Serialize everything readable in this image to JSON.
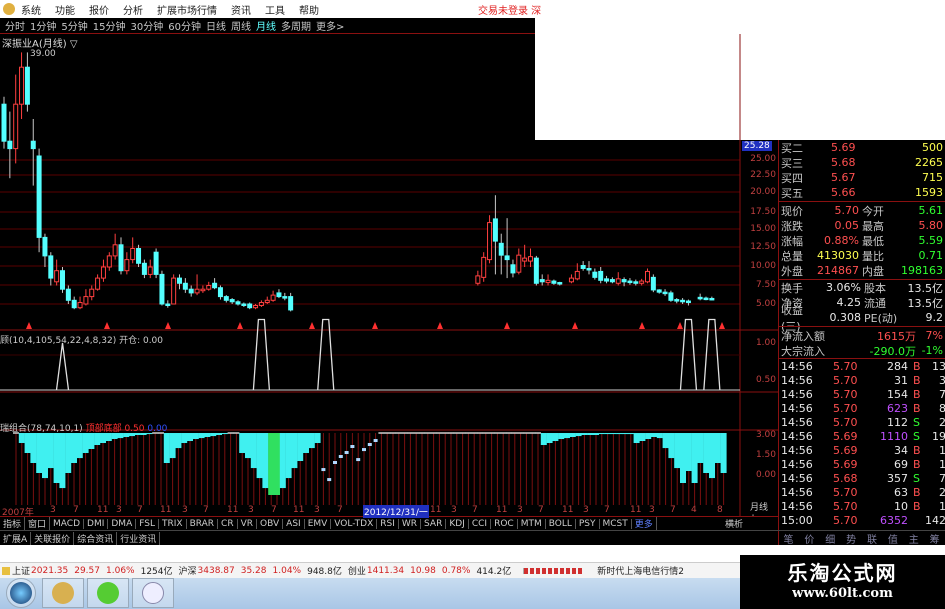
{
  "menu": {
    "items": [
      "系统",
      "功能",
      "报价",
      "分析",
      "扩展市场行情",
      "资讯",
      "工具",
      "帮助"
    ],
    "status": "交易未登录 深"
  },
  "periods": {
    "items": [
      "分时",
      "1分钟",
      "5分钟",
      "15分钟",
      "30分钟",
      "60分钟",
      "日线",
      "周线",
      "月线",
      "多周期",
      "更多>"
    ],
    "selected": "月线"
  },
  "chart": {
    "title": "深振业A(月线) ▽",
    "high_label": "39.00",
    "last_price_tag": "25.28",
    "price_axis": [
      "25.00",
      "22.50",
      "20.00",
      "17.50",
      "15.00",
      "12.50",
      "10.00",
      "7.50",
      "5.00"
    ],
    "colors": {
      "up": "#ff4040",
      "down": "#54ffff",
      "grid": "#5a0000",
      "marker": "#ff3030"
    },
    "candles_ohlc_note": "o,c,h,l per month; null = no trading",
    "candles": [
      [
        32,
        27,
        33,
        26
      ],
      [
        27,
        26,
        31,
        22
      ],
      [
        26,
        32,
        36,
        24
      ],
      [
        32,
        37,
        39,
        30
      ],
      [
        37,
        32,
        39,
        31
      ],
      [
        27,
        26,
        30,
        21
      ],
      [
        25,
        14,
        26,
        12
      ],
      [
        14,
        11.5,
        14.5,
        10
      ],
      [
        11.5,
        8.5,
        12,
        7.5
      ],
      [
        8,
        9.5,
        11,
        7.5
      ],
      [
        9.5,
        7,
        10,
        6.5
      ],
      [
        7,
        5.5,
        7.5,
        5
      ],
      [
        5.5,
        4.5,
        6,
        4.3
      ],
      [
        4.5,
        5.2,
        6,
        4.3
      ],
      [
        5,
        6,
        7,
        4.8
      ],
      [
        6,
        7,
        7.5,
        5.5
      ],
      [
        7,
        8.5,
        9,
        6.8
      ],
      [
        8.5,
        10,
        11,
        8
      ],
      [
        10,
        11.5,
        12,
        9.5
      ],
      [
        11.5,
        13,
        14.5,
        11
      ],
      [
        13,
        9.5,
        14,
        9
      ],
      [
        9.5,
        11,
        12,
        9
      ],
      [
        11,
        12.5,
        14,
        10.5
      ],
      [
        12.5,
        10.5,
        13,
        10
      ],
      [
        10.5,
        9,
        11,
        8.5
      ],
      [
        9,
        10,
        11,
        8.5
      ],
      [
        12,
        9,
        12.5,
        8.5
      ],
      [
        9,
        5,
        9.5,
        4.8
      ],
      [
        5,
        4.8,
        5.5,
        4.5
      ],
      [
        5,
        8.5,
        9,
        5
      ],
      [
        8.5,
        7.8,
        9,
        7
      ],
      [
        7.8,
        7,
        8.5,
        6.5
      ],
      [
        7,
        6.5,
        7.5,
        6
      ],
      [
        6.5,
        7,
        9,
        6.2
      ],
      [
        6.8,
        7,
        7.5,
        6.5
      ],
      [
        7,
        7.5,
        8,
        6.8
      ],
      [
        7.8,
        7.2,
        8.5,
        7
      ],
      [
        7.2,
        6,
        7.5,
        5.6
      ],
      [
        6,
        5.5,
        6.2,
        5.2
      ],
      [
        5.6,
        5.3,
        5.8,
        5
      ],
      [
        5.3,
        5,
        5.5,
        4.8
      ],
      [
        5,
        4.9,
        5.2,
        4.6
      ],
      [
        5,
        4.5,
        5.2,
        4.3
      ],
      [
        4.5,
        4.8,
        5,
        4.3
      ],
      [
        4.8,
        5.2,
        5.5,
        4.6
      ],
      [
        5.2,
        5.5,
        6,
        5
      ],
      [
        5.5,
        6.2,
        6.8,
        5.3
      ],
      [
        6.5,
        6,
        7,
        5.8
      ],
      [
        6,
        5.8,
        6.5,
        5.5
      ],
      [
        6,
        4.2,
        6.5,
        4
      ],
      null,
      null,
      null,
      null,
      null,
      null,
      null,
      null,
      null,
      null,
      null,
      null,
      null,
      null,
      null,
      null,
      null,
      null,
      null,
      null,
      null,
      null,
      null,
      null,
      null,
      null,
      null,
      null,
      null,
      null,
      null,
      [
        7.8,
        8.8,
        9.5,
        7.5
      ],
      [
        8.6,
        11.3,
        12,
        8
      ],
      [
        11,
        16,
        17,
        10.5
      ],
      [
        16.5,
        13.5,
        19.7,
        9
      ],
      [
        13.2,
        11.6,
        14.5,
        9
      ],
      [
        11.5,
        11,
        16.6,
        8.5
      ],
      [
        10.3,
        9.2,
        11,
        8.6
      ],
      [
        9.3,
        11.6,
        12.5,
        9
      ],
      [
        10.8,
        11.2,
        13,
        10
      ],
      [
        10.8,
        11.4,
        12.5,
        10
      ],
      [
        11.2,
        7.8,
        11.5,
        7.5
      ],
      [
        8.3,
        8,
        9,
        7.5
      ],
      [
        7.9,
        8.2,
        9,
        7.5
      ],
      [
        8.1,
        7.8,
        8.3,
        7.6
      ],
      [
        7.9,
        7.7,
        8,
        7.5
      ],
      null,
      [
        8,
        8.5,
        9,
        7.8
      ],
      [
        8.4,
        9.4,
        10.5,
        8.2
      ],
      [
        10.2,
        9.8,
        10.8,
        9.5
      ],
      [
        9.8,
        9.6,
        10.8,
        9
      ],
      [
        9.3,
        8.6,
        9.8,
        8.3
      ],
      [
        9.4,
        8.2,
        10,
        7.8
      ],
      [
        8.4,
        8.1,
        8.8,
        7.8
      ],
      [
        8.3,
        8,
        8.6,
        7.8
      ],
      [
        7.8,
        8.4,
        9.3,
        7.5
      ],
      [
        8.3,
        8,
        8.6,
        7.4
      ],
      [
        8.1,
        7.9,
        8.5,
        7.6
      ],
      [
        8,
        7.8,
        8.3,
        7.5
      ],
      [
        7.8,
        8.1,
        8.4,
        7.5
      ],
      [
        8,
        9.4,
        9.8,
        7.8
      ],
      [
        8.6,
        6.9,
        9,
        6.6
      ],
      [
        6.9,
        6.6,
        7,
        6.4
      ],
      [
        6.6,
        6.4,
        7,
        6.1
      ],
      [
        6.5,
        5.5,
        6.8,
        5.3
      ],
      [
        5.6,
        5.4,
        5.8,
        5.1
      ],
      [
        5.5,
        5.3,
        5.8,
        5
      ],
      [
        5.4,
        5.2,
        5.6,
        4.8
      ],
      null,
      [
        5.9,
        5.7,
        6.4,
        5.5
      ],
      [
        5.8,
        5.6,
        6,
        5.5
      ],
      [
        5.75,
        5.7,
        6,
        5.5
      ]
    ]
  },
  "pane1": {
    "label": "顾(10,4,105,54,22,4,8,32) 开仓: 0.00",
    "axis": [
      "1.00",
      "0.50"
    ],
    "spike_months": [
      10,
      44,
      55,
      117,
      121
    ],
    "spike_values": [
      1,
      1.5,
      1.5,
      1.5,
      1.5
    ]
  },
  "pane2": {
    "label": "瑞组合(78,74,10,1)",
    "label2": "顶部底部 0.50",
    "label3": "0.00",
    "axis": [
      "3.00",
      "1.50",
      "0.00"
    ],
    "bar_colors": {
      "normal": "#40f0f0",
      "deep": "#30e060",
      "flat": "#d0d0d0",
      "stem": "#7a1010"
    },
    "values": [
      3.15,
      2.4,
      1.65,
      0.9,
      0.15,
      -0.23,
      0.52,
      -0.6,
      -0.98,
      0.15,
      0.9,
      1.27,
      1.65,
      1.95,
      2.25,
      2.4,
      2.55,
      2.7,
      2.77,
      2.85,
      2.92,
      3.0,
      3.0,
      3.07,
      3.15,
      3.15,
      0.9,
      1.27,
      2.02,
      2.4,
      2.55,
      2.7,
      2.77,
      2.85,
      2.92,
      3.0,
      3.07,
      3.15,
      3.15,
      1.65,
      1.27,
      0.52,
      -0.23,
      -0.98,
      -1.5,
      -1.5,
      -0.98,
      -0.23,
      0.52,
      1.05,
      1.65,
      2.02,
      2.4
    ],
    "dots": [
      0.52,
      -0.23,
      1.05,
      1.5,
      1.8,
      2.25,
      1.27,
      2.02,
      2.4,
      2.7
    ],
    "tail_values": [
      2.25,
      2.4,
      2.55,
      2.7,
      2.77,
      2.85,
      2.92,
      3.0,
      3.0,
      3.0,
      3.07,
      3.07,
      3.07,
      3.07,
      3.07,
      3.07,
      2.4,
      2.55,
      2.7,
      2.85,
      2.77,
      2.02,
      1.27,
      0.52,
      -0.6,
      0.3,
      -0.6,
      0.9,
      0.15,
      -0.23,
      0.9,
      0.15
    ]
  },
  "xaxis": {
    "labels": [
      "2007年",
      "3",
      "7",
      "11",
      "3",
      "7",
      "11",
      "3",
      "7",
      "11",
      "3",
      "7",
      "11",
      "3",
      "7",
      "2012/12/31/一",
      "11",
      "3",
      "7",
      "11",
      "3",
      "7",
      "11",
      "3",
      "7",
      "11",
      "3",
      "7",
      "4",
      "8"
    ],
    "highlight": "2012/12/31/一",
    "period": "月线",
    "plus": "+",
    "minus": "-"
  },
  "indicators": {
    "items": [
      "指标",
      "窗口",
      "MACD",
      "DMI",
      "DMA",
      "FSL",
      "TRIX",
      "BRAR",
      "CR",
      "VR",
      "OBV",
      "ASI",
      "EMV",
      "VOL-TDX",
      "RSI",
      "WR",
      "SAR",
      "KDJ",
      "CCI",
      "ROC",
      "MTM",
      "BOLL",
      "PSY",
      "MCST"
    ],
    "more": "更多",
    "right": "横析"
  },
  "ext_tabs": [
    "扩展A",
    "关联报价",
    "综合资讯",
    "行业资讯"
  ],
  "quote": {
    "bids": [
      {
        "label": "买二",
        "price": "5.69",
        "vol": "500"
      },
      {
        "label": "买三",
        "price": "5.68",
        "vol": "2265"
      },
      {
        "label": "买四",
        "price": "5.67",
        "vol": "715"
      },
      {
        "label": "买五",
        "price": "5.66",
        "vol": "1593"
      }
    ],
    "stats": [
      {
        "l1": "现价",
        "v1": "5.70",
        "c1": "red",
        "l2": "今开",
        "v2": "5.61",
        "c2": "grn"
      },
      {
        "l1": "涨跌",
        "v1": "0.05",
        "c1": "red",
        "l2": "最高",
        "v2": "5.80",
        "c2": "red"
      },
      {
        "l1": "涨幅",
        "v1": "0.88%",
        "c1": "red",
        "l2": "最低",
        "v2": "5.59",
        "c2": "grn"
      },
      {
        "l1": "总量",
        "v1": "413030",
        "c1": "yel",
        "l2": "量比",
        "v2": "0.71",
        "c2": "grn"
      },
      {
        "l1": "外盘",
        "v1": "214867",
        "c1": "red",
        "l2": "内盘",
        "v2": "198163",
        "c2": "grn"
      }
    ],
    "fund": [
      {
        "l1": "换手",
        "v1": "3.06%",
        "l2": "股本",
        "v2": "13.5亿"
      },
      {
        "l1": "净资",
        "v1": "4.25",
        "l2": "流通",
        "v2": "13.5亿"
      },
      {
        "l1": "收益(三)",
        "v1": "0.308",
        "l2": "PE(动)",
        "v2": "9.2"
      }
    ],
    "flow": [
      {
        "label": "净流入额",
        "value": "1615万",
        "pct": "7%",
        "c": "red"
      },
      {
        "label": "大宗流入",
        "value": "-290.0万",
        "pct": "-1%",
        "c": "grn"
      }
    ],
    "ticks": [
      {
        "t": "14:56",
        "p": "5.70",
        "v": "284",
        "bs": "B",
        "n": "13"
      },
      {
        "t": "14:56",
        "p": "5.70",
        "v": "31",
        "bs": "B",
        "n": "3"
      },
      {
        "t": "14:56",
        "p": "5.70",
        "v": "154",
        "bs": "B",
        "n": "7"
      },
      {
        "t": "14:56",
        "p": "5.70",
        "v": "623",
        "bs": "B",
        "n": "8"
      },
      {
        "t": "14:56",
        "p": "5.70",
        "v": "112",
        "bs": "S",
        "n": "2"
      },
      {
        "t": "14:56",
        "p": "5.69",
        "v": "1110",
        "bs": "S",
        "n": "19"
      },
      {
        "t": "14:56",
        "p": "5.69",
        "v": "34",
        "bs": "B",
        "n": "1"
      },
      {
        "t": "14:56",
        "p": "5.69",
        "v": "69",
        "bs": "B",
        "n": "1"
      },
      {
        "t": "14:56",
        "p": "5.68",
        "v": "357",
        "bs": "S",
        "n": "7"
      },
      {
        "t": "14:56",
        "p": "5.70",
        "v": "63",
        "bs": "B",
        "n": "2"
      },
      {
        "t": "14:56",
        "p": "5.70",
        "v": "10",
        "bs": "B",
        "n": "1"
      },
      {
        "t": "15:00",
        "p": "5.70",
        "v": "6352",
        "bs": "",
        "n": "142"
      }
    ],
    "tabs": [
      "笔",
      "价",
      "细",
      "势",
      "联",
      "值",
      "主",
      "筹"
    ]
  },
  "status_bar": {
    "items": [
      "上证",
      "2021.35",
      "29.57",
      "1.06%",
      "1254亿",
      "沪深",
      "3438.87",
      "35.28",
      "1.04%",
      "948.8亿",
      "创业",
      "1411.34",
      "10.98",
      "0.78%",
      "414.2亿"
    ],
    "feed": "新时代上海电信行情2"
  },
  "watermark": {
    "name": "乐淘公式网",
    "url": "www.60lt.com"
  }
}
